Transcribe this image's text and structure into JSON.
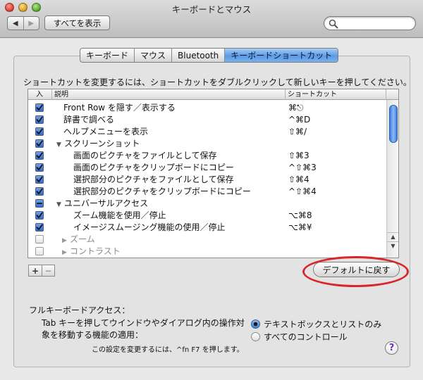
{
  "window": {
    "title": "キーボードとマウス",
    "back_label": "◀",
    "forward_label": "▶",
    "show_all_label": "すべてを表示",
    "search": {
      "value": "",
      "placeholder": ""
    }
  },
  "tabs": [
    {
      "label": "キーボード",
      "active": false
    },
    {
      "label": "マウス",
      "active": false
    },
    {
      "label": "Bluetooth",
      "active": false
    },
    {
      "label": "キーボードショートカット",
      "active": true
    }
  ],
  "instructions": "ショートカットを変更するには、ショートカットをダブルクリックして新しいキーを押してください。",
  "table": {
    "columns": [
      "入",
      "説明",
      "ショートカット"
    ],
    "rows": [
      {
        "checked": "on",
        "label": "Front Row を隠す／表示する",
        "shortcut": "⌘⎋",
        "level": 1,
        "triangle": ""
      },
      {
        "checked": "on",
        "label": "辞書で調べる",
        "shortcut": "^⌘D",
        "level": 1,
        "triangle": ""
      },
      {
        "checked": "on",
        "label": "ヘルプメニューを表示",
        "shortcut": "⇧⌘/",
        "level": 1,
        "triangle": ""
      },
      {
        "checked": "on",
        "label": "スクリーンショット",
        "shortcut": "",
        "level": 0,
        "triangle": "▼"
      },
      {
        "checked": "on",
        "label": "画面のピクチャをファイルとして保存",
        "shortcut": "⇧⌘3",
        "level": 2,
        "triangle": ""
      },
      {
        "checked": "on",
        "label": "画面のピクチャをクリップボードにコピー",
        "shortcut": "^⇧⌘3",
        "level": 2,
        "triangle": ""
      },
      {
        "checked": "on",
        "label": "選択部分のピクチャをファイルとして保存",
        "shortcut": "⇧⌘4",
        "level": 2,
        "triangle": ""
      },
      {
        "checked": "on",
        "label": "選択部分のピクチャをクリップボードにコピー",
        "shortcut": "^⇧⌘4",
        "level": 2,
        "triangle": ""
      },
      {
        "checked": "mixed",
        "label": "ユニバーサルアクセス",
        "shortcut": "",
        "level": 0,
        "triangle": "▼"
      },
      {
        "checked": "on",
        "label": "ズーム機能を使用／停止",
        "shortcut": "⌥⌘8",
        "level": 2,
        "triangle": ""
      },
      {
        "checked": "on",
        "label": "イメージスムージング機能の使用／停止",
        "shortcut": "⌥⌘¥",
        "level": 2,
        "triangle": ""
      },
      {
        "checked": "off",
        "label": "ズーム",
        "shortcut": "",
        "level": 1,
        "triangle": "▶",
        "disabled": true
      },
      {
        "checked": "off",
        "label": "コントラスト",
        "shortcut": "",
        "level": 1,
        "triangle": "▶",
        "disabled": true
      }
    ]
  },
  "buttons": {
    "add_label": "+",
    "remove_label": "−",
    "restore_defaults_label": "デフォルトに戻す"
  },
  "full_keyboard_access": {
    "title": "フルキーボードアクセス：",
    "description": "Tab キーを押してウインドウやダイアログ内の操作対象を移動する機能の適用：",
    "options": [
      {
        "label": "テキストボックスとリストのみ",
        "selected": true
      },
      {
        "label": "すべてのコントロール",
        "selected": false
      }
    ],
    "hint": "この設定を変更するには、^fn F7 を押します。",
    "help_label": "?"
  },
  "colors": {
    "accent": "#3f7fde",
    "annotation_circle": "#d8262b",
    "help_glyph": "#6a2fb8"
  }
}
